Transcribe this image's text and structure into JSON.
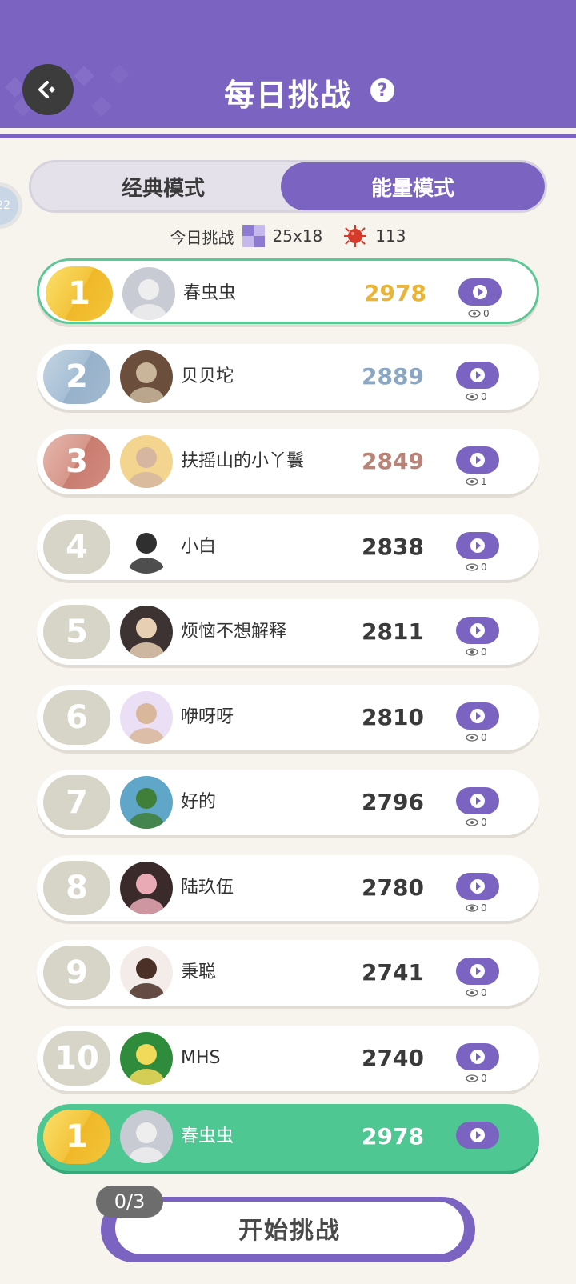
{
  "header": {
    "title": "每日挑战",
    "side_badge": "22"
  },
  "tabs": [
    {
      "label": "经典模式",
      "active": false
    },
    {
      "label": "能量模式",
      "active": true
    }
  ],
  "today": {
    "label": "今日挑战",
    "grid_size": "25x18",
    "virus_count": "113"
  },
  "leaderboard": [
    {
      "rank": "1",
      "name": "春虫虫",
      "score": "2978",
      "views": "0",
      "medal": "gold",
      "score_color": "#e8b43a",
      "avatar_colors": [
        "#c8cbd3",
        "#eeeeee"
      ]
    },
    {
      "rank": "2",
      "name": "贝贝坨",
      "score": "2889",
      "views": "0",
      "medal": "silver",
      "score_color": "#8aa6c2",
      "avatar_colors": [
        "#6b4f3c",
        "#c8b59a"
      ]
    },
    {
      "rank": "3",
      "name": "扶摇山的小丫鬟",
      "score": "2849",
      "views": "1",
      "medal": "bronze",
      "score_color": "#b98378",
      "avatar_colors": [
        "#f3d58f",
        "#d6b6a0"
      ]
    },
    {
      "rank": "4",
      "name": "小白",
      "score": "2838",
      "views": "0",
      "medal": "plain",
      "score_color": "#3a3a3a",
      "avatar_colors": [
        "#ffffff",
        "#2f2f2f"
      ]
    },
    {
      "rank": "5",
      "name": "烦恼不想解释",
      "score": "2811",
      "views": "0",
      "medal": "plain",
      "score_color": "#3a3a3a",
      "avatar_colors": [
        "#3e3333",
        "#e7cfb4"
      ]
    },
    {
      "rank": "6",
      "name": "咿呀呀",
      "score": "2810",
      "views": "0",
      "medal": "plain",
      "score_color": "#3a3a3a",
      "avatar_colors": [
        "#ebdff5",
        "#d9b79a"
      ]
    },
    {
      "rank": "7",
      "name": "好的",
      "score": "2796",
      "views": "0",
      "medal": "plain",
      "score_color": "#3a3a3a",
      "avatar_colors": [
        "#5fa6c9",
        "#3f7f3a"
      ]
    },
    {
      "rank": "8",
      "name": "陆玖伍",
      "score": "2780",
      "views": "0",
      "medal": "plain",
      "score_color": "#3a3a3a",
      "avatar_colors": [
        "#3a2a2a",
        "#e9a9b5"
      ]
    },
    {
      "rank": "9",
      "name": "秉聪",
      "score": "2741",
      "views": "0",
      "medal": "plain",
      "score_color": "#3a3a3a",
      "avatar_colors": [
        "#f4ece8",
        "#4a3027"
      ]
    },
    {
      "rank": "10",
      "name": "MHS",
      "score": "2740",
      "views": "0",
      "medal": "plain",
      "score_color": "#3a3a3a",
      "avatar_colors": [
        "#2f8c3c",
        "#f1d95a"
      ]
    }
  ],
  "my_entry": {
    "rank": "1",
    "name": "春虫虫",
    "score": "2978",
    "avatar_colors": [
      "#c8cbd3",
      "#eeeeee"
    ]
  },
  "start": {
    "label": "开始挑战",
    "attempts": "0/3"
  },
  "colors": {
    "primary": "#7b63c1",
    "highlight_green": "#4fc792",
    "background": "#f7f4ee"
  }
}
